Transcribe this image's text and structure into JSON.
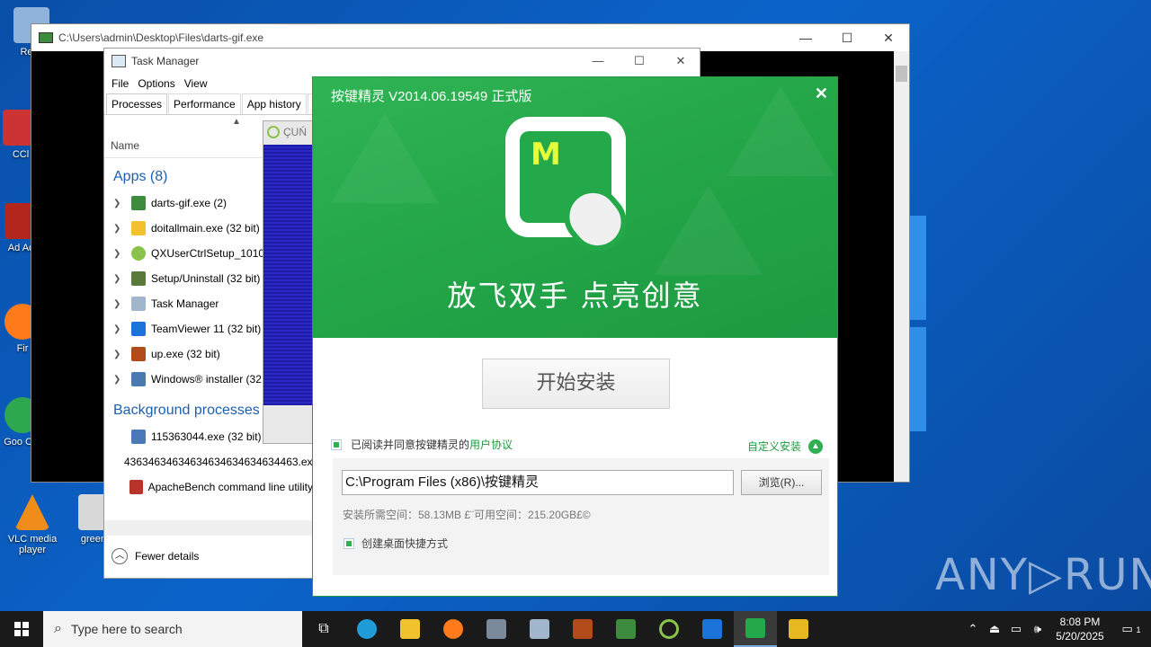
{
  "desktop": {
    "icons": [
      {
        "label": "Recy",
        "color": "#8fb3d9"
      },
      {
        "label": "CCl",
        "color": "#cc3333"
      },
      {
        "label": "Ad Acr",
        "color": "#b3261e"
      },
      {
        "label": "Fir",
        "color": "#ff7a1a"
      },
      {
        "label": "Goo Chr",
        "color": "#2ea84f"
      },
      {
        "label": "VLC media player",
        "color": "#f08c1a"
      },
      {
        "label": "greenp",
        "color": "#d8d8d8"
      }
    ],
    "watermark": "ANY▷RUN"
  },
  "darts_window": {
    "title": "C:\\Users\\admin\\Desktop\\Files\\darts-gif.exe",
    "minimize": "—",
    "maximize": "☐",
    "close": "✕"
  },
  "task_manager": {
    "title": "Task Manager",
    "minimize": "—",
    "maximize": "☐",
    "close": "✕",
    "menu": [
      "File",
      "Options",
      "View"
    ],
    "tabs": [
      "Processes",
      "Performance",
      "App history",
      "St"
    ],
    "column_name": "Name",
    "apps_header": "Apps (8)",
    "apps": [
      {
        "label": "darts-gif.exe (2)",
        "color": "#3d8b3d"
      },
      {
        "label": "doitallmain.exe (32 bit)",
        "color": "#f2c12e"
      },
      {
        "label": "QXUserCtrlSetup_1010.e",
        "color": "#8bc34a"
      },
      {
        "label": "Setup/Uninstall (32 bit) (",
        "color": "#5a7a3a"
      },
      {
        "label": "Task Manager",
        "color": "#9fb6cc"
      },
      {
        "label": "TeamViewer 11 (32 bit) (",
        "color": "#1a73d9"
      },
      {
        "label": "up.exe (32 bit)",
        "color": "#b34a1a"
      },
      {
        "label": "Windows® installer (32",
        "color": "#4a7ab0"
      }
    ],
    "bg_header": "Background processes (",
    "background": [
      {
        "label": "115363044.exe (32 bit)",
        "color": "#4a78b8"
      },
      {
        "label": "43634634634634634634634634463.exe (3",
        "color": "#4a78b8"
      },
      {
        "label": "ApacheBench command line utility",
        "color": "#b8332a"
      }
    ],
    "fewer_details": "Fewer details"
  },
  "qx_window": {
    "title": "ÇUŃ"
  },
  "installer": {
    "title": "按键精灵 V2014.06.19549 正式版",
    "close": "✕",
    "logo_letter": "M",
    "slogan": "放飞双手  点亮创意",
    "install_button": "开始安装",
    "agree_text": "已阅读并同意按键精灵的",
    "agree_link": "用户协议",
    "custom_install": "自定义安装",
    "path_value": "C:\\Program Files (x86)\\按键精灵",
    "browse_button": "浏览(R)...",
    "space_text": "安装所需空间：58.13MB £¨可用空间：215.20GB£©",
    "shortcut_text": "创建桌面快捷方式"
  },
  "taskbar": {
    "search_placeholder": "Type here to search",
    "time": "8:08 PM",
    "date": "5/20/2025",
    "notification_count": "1"
  }
}
